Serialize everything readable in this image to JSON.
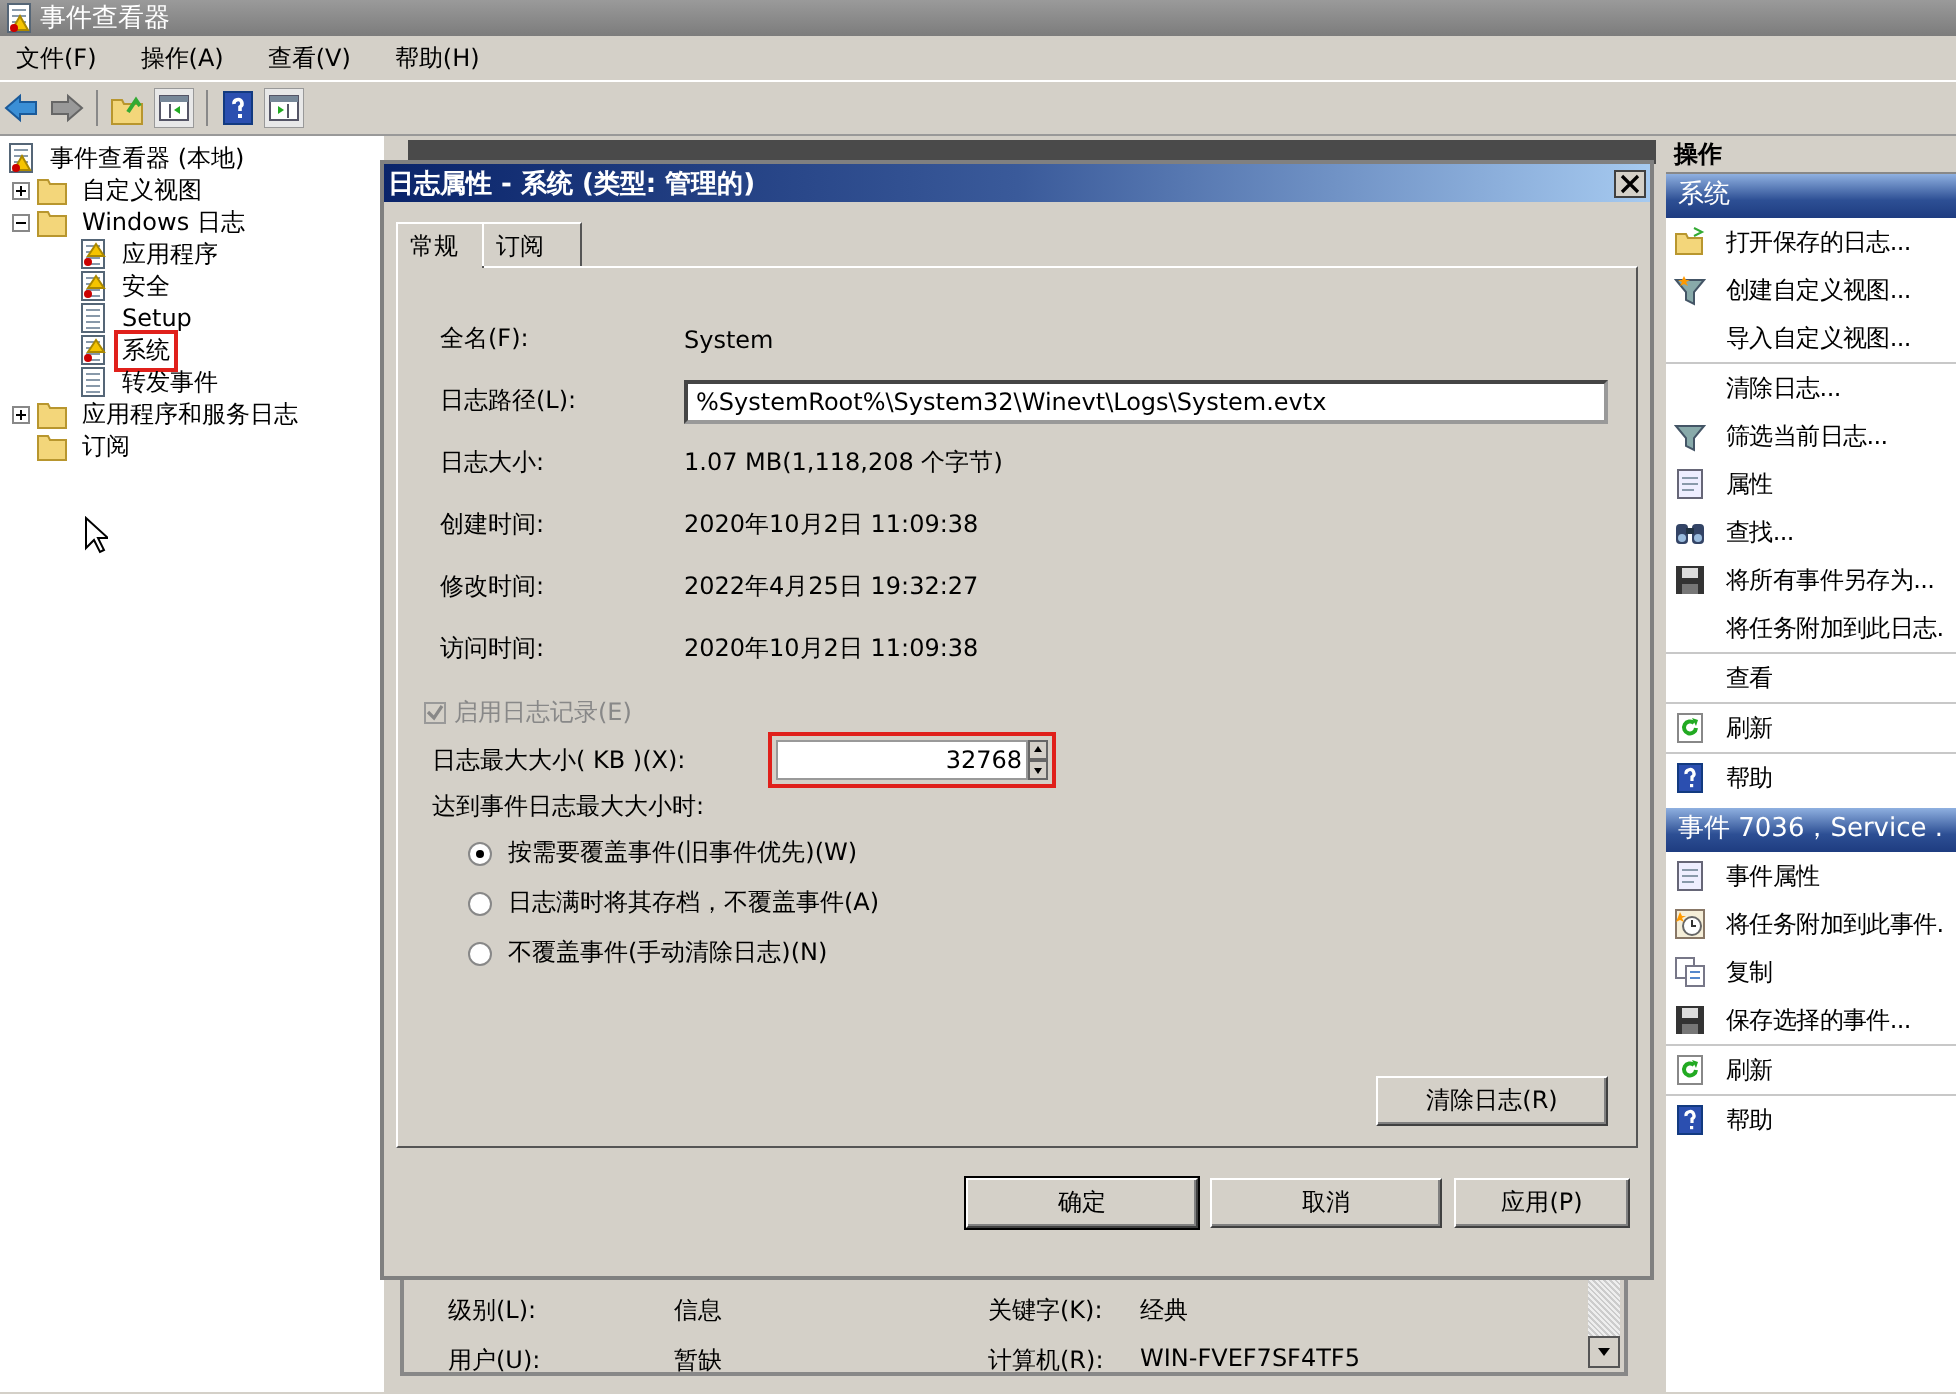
{
  "window": {
    "title": "事件查看器"
  },
  "menu": [
    "文件(F)",
    "操作(A)",
    "查看(V)",
    "帮助(H)"
  ],
  "tree": [
    {
      "label": "事件查看器 (本地)",
      "kind": "viewer",
      "selected": false,
      "children": [
        {
          "label": "自定义视图",
          "kind": "folder",
          "expanded": false,
          "selected": false
        },
        {
          "label": "Windows 日志",
          "kind": "folder",
          "expanded": true,
          "selected": false,
          "children": [
            {
              "label": "应用程序",
              "kind": "alert",
              "selected": false
            },
            {
              "label": "安全",
              "kind": "alert",
              "selected": false
            },
            {
              "label": "Setup",
              "kind": "log",
              "selected": false
            },
            {
              "label": "系统",
              "kind": "alert",
              "selected": true
            },
            {
              "label": "转发事件",
              "kind": "log",
              "selected": false
            }
          ]
        },
        {
          "label": "应用程序和服务日志",
          "kind": "folder",
          "expanded": false,
          "selected": false
        },
        {
          "label": "订阅",
          "kind": "folder",
          "selected": false
        }
      ]
    }
  ],
  "dialog": {
    "title": "日志属性 - 系统 (类型: 管理的)",
    "tabs": [
      {
        "label": "常规",
        "selected": true
      },
      {
        "label": "订阅",
        "selected": false
      }
    ],
    "fields": [
      {
        "kind": "text",
        "label": "全名(F):",
        "value": "System"
      },
      {
        "kind": "input",
        "label": "日志路径(L):",
        "value": "%SystemRoot%\\System32\\Winevt\\Logs\\System.evtx"
      },
      {
        "kind": "text",
        "label": "日志大小:",
        "value": "1.07 MB(1,118,208 个字节)"
      },
      {
        "kind": "text",
        "label": "创建时间:",
        "value": "2020年10月2日 11:09:38"
      },
      {
        "kind": "text",
        "label": "修改时间:",
        "value": "2022年4月25日 19:32:27"
      },
      {
        "kind": "text",
        "label": "访问时间:",
        "value": "2020年10月2日 11:09:38"
      }
    ],
    "enable_logging": {
      "label": "启用日志记录(E)",
      "checked": true,
      "disabled": true
    },
    "max_size": {
      "label": "日志最大大小( KB )(X):",
      "value": "32768",
      "highlighted": true
    },
    "policy_label": "达到事件日志最大大小时:",
    "policies": [
      {
        "label": "按需要覆盖事件(旧事件优先)(W)",
        "selected": true
      },
      {
        "label": "日志满时将其存档，不覆盖事件(A)",
        "selected": false
      },
      {
        "label": "不覆盖事件(手动清除日志)(N)",
        "selected": false
      }
    ],
    "clear_button": "清除日志(R)",
    "buttons": [
      {
        "label": "确定",
        "default": true
      },
      {
        "label": "取消",
        "default": false
      },
      {
        "label": "应用(P)",
        "default": false
      }
    ]
  },
  "details": [
    {
      "label": "级别(L):",
      "value": "信息"
    },
    {
      "label": "关键字(K):",
      "value": "经典"
    },
    {
      "label": "用户(U):",
      "value": "暂缺"
    },
    {
      "label": "计算机(R):",
      "value": "WIN-FVEF7SF4TF5"
    }
  ],
  "actions": {
    "title": "操作",
    "sections": [
      {
        "title": "系统",
        "groups": [
          [
            {
              "label": "打开保存的日志...",
              "kind": "open"
            },
            {
              "label": "创建自定义视图...",
              "kind": "create"
            },
            {
              "label": "导入自定义视图...",
              "kind": "plain"
            }
          ],
          [
            {
              "label": "清除日志...",
              "kind": "plain"
            },
            {
              "label": "筛选当前日志...",
              "kind": "filter"
            },
            {
              "label": "属性",
              "kind": "props"
            },
            {
              "label": "查找...",
              "kind": "find"
            },
            {
              "label": "将所有事件另存为...",
              "kind": "save"
            },
            {
              "label": "将任务附加到此日志.",
              "kind": "plain"
            }
          ],
          [
            {
              "label": "查看",
              "kind": "plain"
            }
          ],
          [
            {
              "label": "刷新",
              "kind": "refresh"
            }
          ],
          [
            {
              "label": "帮助",
              "kind": "help"
            }
          ]
        ]
      },
      {
        "title": "事件 7036，Service .",
        "groups": [
          [
            {
              "label": "事件属性",
              "kind": "props"
            },
            {
              "label": "将任务附加到此事件.",
              "kind": "task"
            },
            {
              "label": "复制",
              "kind": "copy"
            },
            {
              "label": "保存选择的事件...",
              "kind": "save"
            }
          ],
          [
            {
              "label": "刷新",
              "kind": "refresh"
            }
          ],
          [
            {
              "label": "帮助",
              "kind": "help"
            }
          ]
        ]
      }
    ]
  }
}
